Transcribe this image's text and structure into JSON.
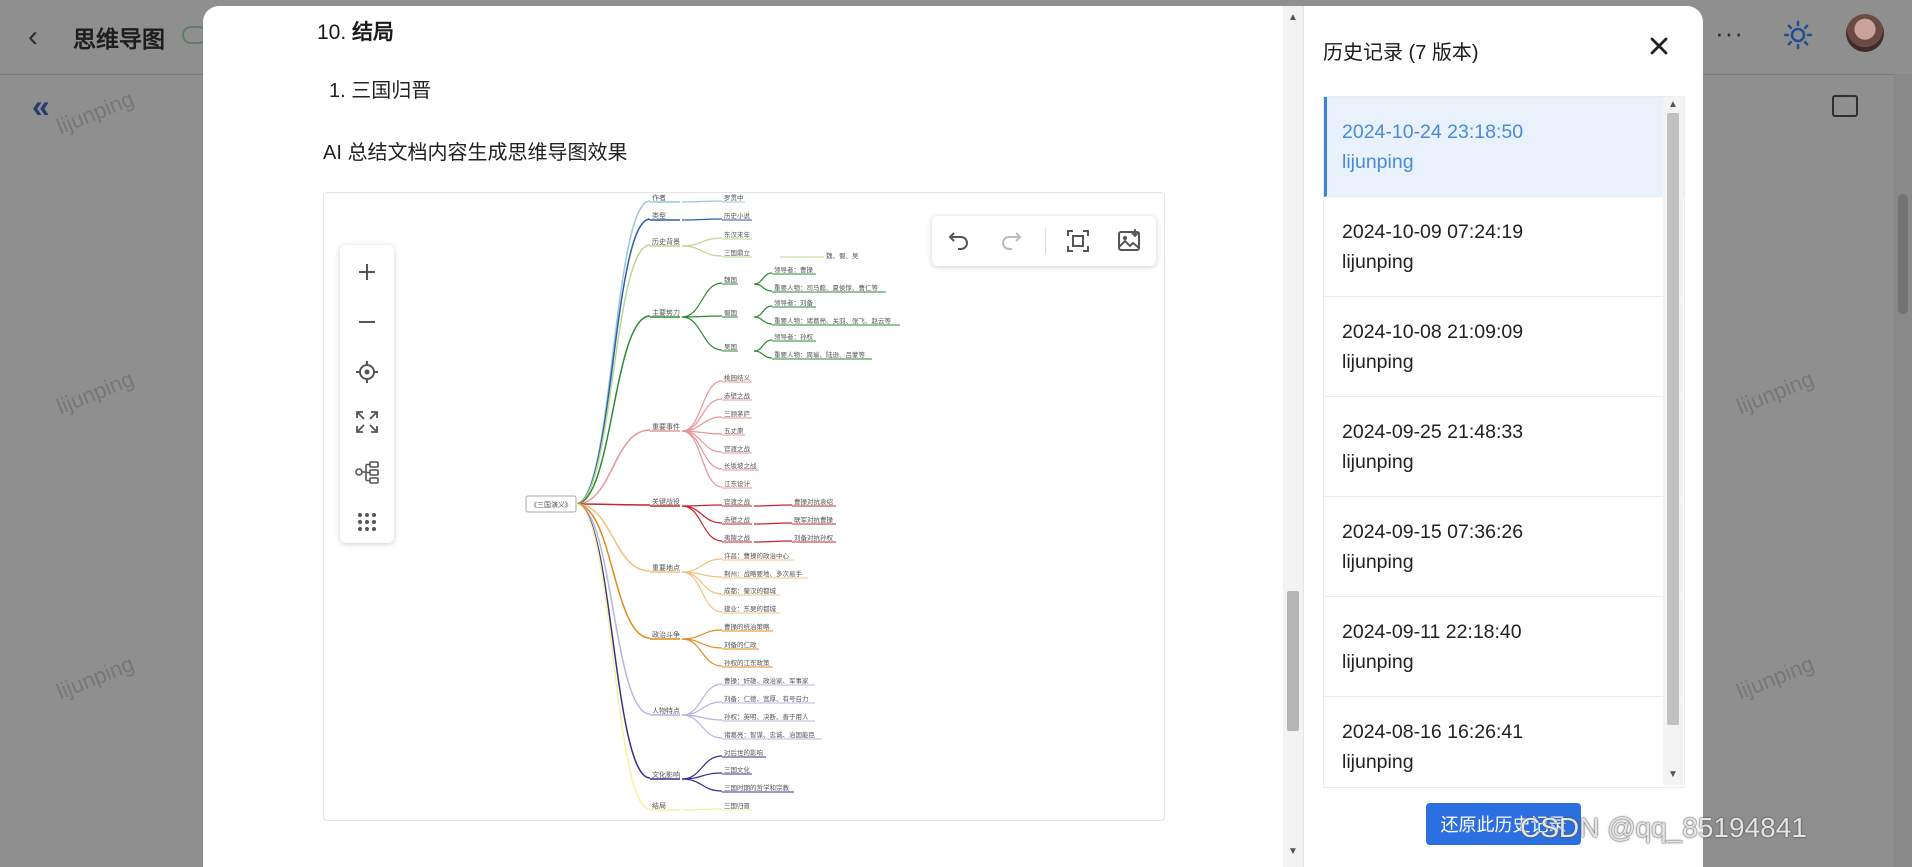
{
  "app": {
    "title": "思维导图",
    "watermark": "lijunping"
  },
  "document": {
    "heading": "10. ",
    "heading_bold": "结局",
    "list_item": "1. 三国归晋",
    "paragraph": "AI 总结文档内容生成思维导图效果"
  },
  "mindmap": {
    "toolbar": [
      "undo-icon",
      "redo-icon",
      "fit-screen-icon",
      "export-image-icon"
    ],
    "side_controls": [
      "zoom-in-icon",
      "zoom-out-icon",
      "locate-icon",
      "fullscreen-icon",
      "structure-icon",
      "more-grid-icon"
    ],
    "root": "《三国演义》",
    "branches": [
      {
        "name": "作者",
        "color": "#9bc7d8",
        "children": [
          "罗贯中"
        ]
      },
      {
        "name": "类型",
        "color": "#2f5fa8",
        "children": [
          "历史小说"
        ]
      },
      {
        "name": "历史背景",
        "color": "#b9d88f",
        "children": [
          "东汉末年",
          "三国鼎立"
        ],
        "extra": "魏、蜀、吴"
      },
      {
        "name": "主要势力",
        "color": "#2c8a2f",
        "children": [
          "魏国",
          "蜀国",
          "吴国"
        ]
      },
      {
        "name": "重要事件",
        "color": "#e8969a",
        "children": [
          "桃园结义",
          "赤壁之战",
          "三顾茅庐",
          "五丈原",
          "官渡之战",
          "长坂坡之战",
          "江东设计"
        ]
      },
      {
        "name": "关键战役",
        "color": "#c8252c",
        "children": [
          "官渡之战",
          "赤壁之战",
          "夷陵之战"
        ]
      },
      {
        "name": "重要地点",
        "color": "#f0c280",
        "children": [
          "许昌：曹操的政治中心",
          "荆州：战略要地、多次易手",
          "成都：蜀汉的都城",
          "建业：东吴的都城"
        ]
      },
      {
        "name": "政治斗争",
        "color": "#e38a1c",
        "children": [
          "曹操的统治策略",
          "刘备的仁政",
          "孙权的江东政策"
        ]
      },
      {
        "name": "人物特点",
        "color": "#b8b4e0",
        "children": [
          "曹操：奸雄、政治家、军事家",
          "刘备：仁德、宽厚、有号召力",
          "孙权：英明、决断、善于用人",
          "诸葛亮：智谋、忠诚、治国能臣"
        ]
      },
      {
        "name": "文化影响",
        "color": "#3b2f8a",
        "children": [
          "对后世的影响",
          "三国文化",
          "三国时期的哲学和宗教"
        ]
      },
      {
        "name": "结局",
        "color": "#f5f1a0",
        "children": [
          "三国归晋"
        ]
      }
    ],
    "sub_leaves": {
      "魏国": [
        "领导者：曹操",
        "重要人物：司马懿、夏侯惇、曹仁等"
      ],
      "蜀国": [
        "领导者：刘备",
        "重要人物：诸葛亮、关羽、张飞、赵云等"
      ],
      "吴国": [
        "领导者：孙权",
        "重要人物：周瑜、陆逊、吕蒙等"
      ],
      "官渡之战": [
        "曹操对抗袁绍"
      ],
      "赤壁之战": [
        "联军对抗曹操"
      ],
      "夷陵之战": [
        "刘备对抗孙权"
      ]
    }
  },
  "history": {
    "title": "历史记录 (7 版本)",
    "items": [
      {
        "date": "2024-10-24 23:18:50",
        "user": "lijunping",
        "active": true
      },
      {
        "date": "2024-10-09 07:24:19",
        "user": "lijunping"
      },
      {
        "date": "2024-10-08 21:09:09",
        "user": "lijunping"
      },
      {
        "date": "2024-09-25 21:48:33",
        "user": "lijunping"
      },
      {
        "date": "2024-09-15 07:36:26",
        "user": "lijunping"
      },
      {
        "date": "2024-09-11 22:18:40",
        "user": "lijunping"
      },
      {
        "date": "2024-08-16 16:26:41",
        "user": "lijunping"
      }
    ],
    "restore_label": "还原此历史记录"
  },
  "credit": "CSDN @qq_85194841"
}
